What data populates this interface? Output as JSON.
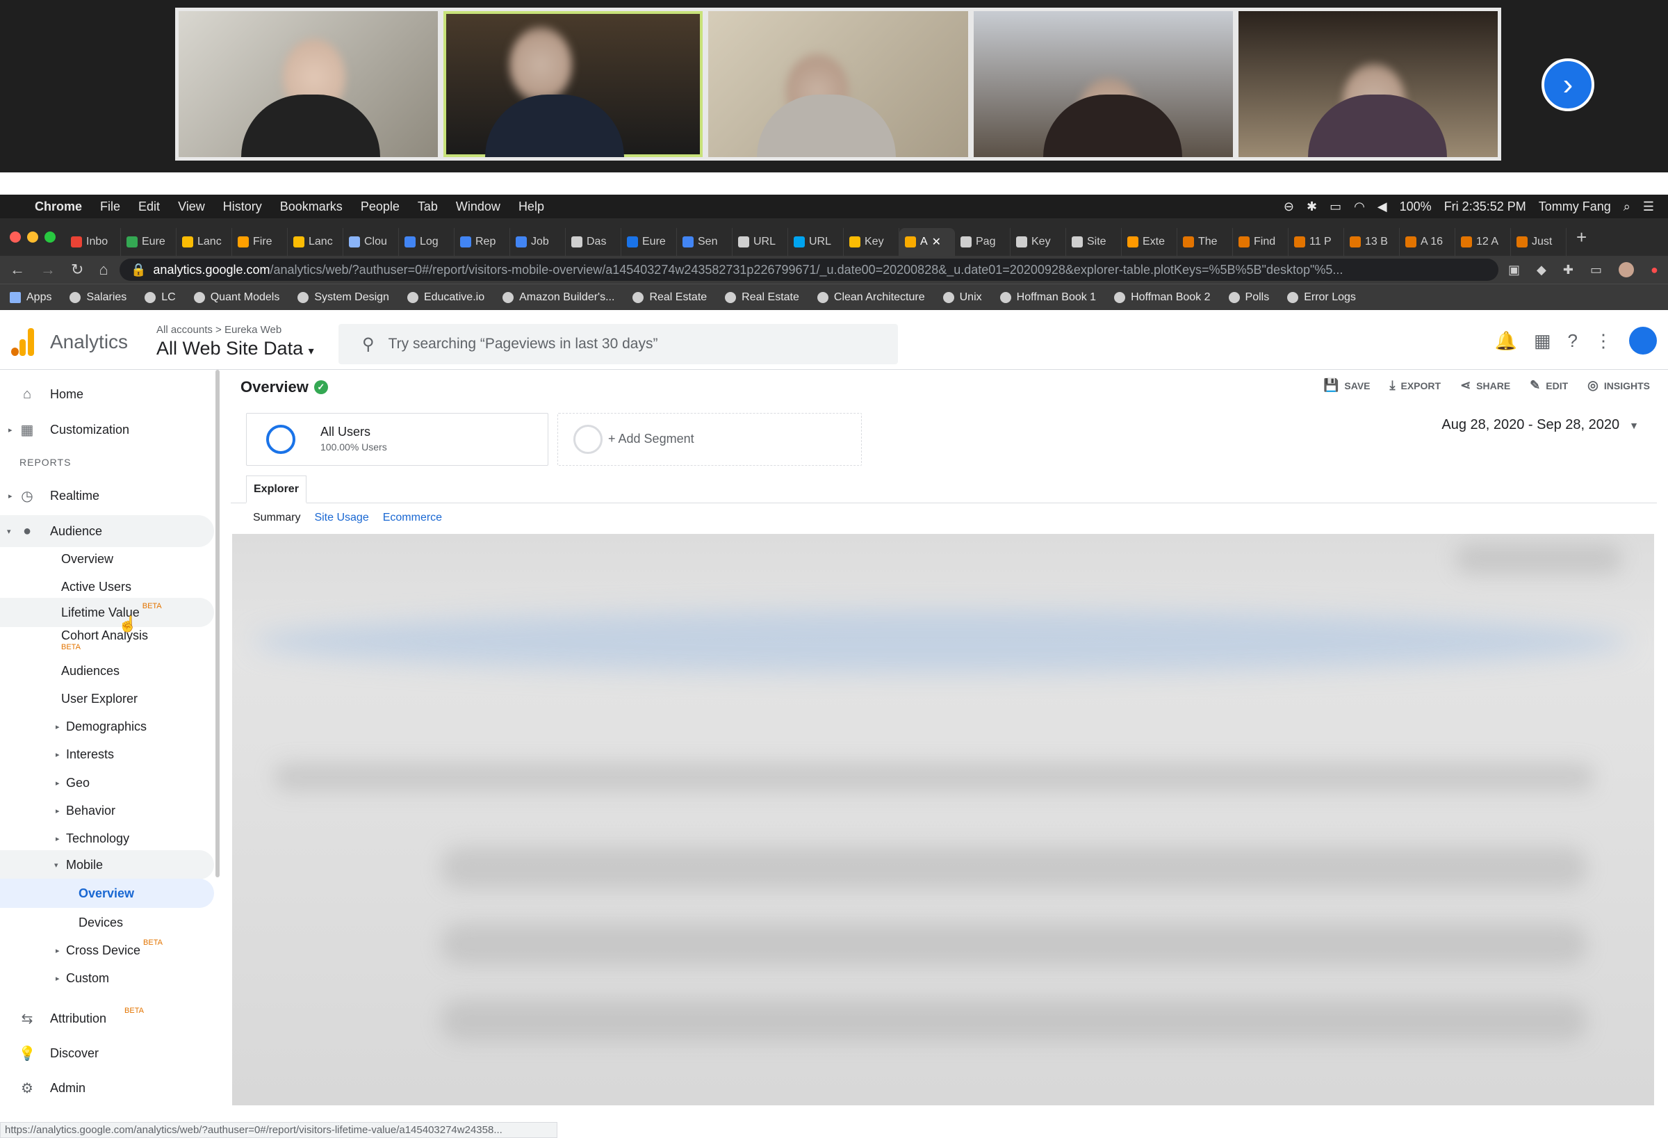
{
  "video_call": {
    "participants": [
      "participant-1",
      "participant-2",
      "participant-3",
      "participant-4",
      "participant-5"
    ],
    "next_label": "›"
  },
  "mac_menubar": {
    "items": [
      "Chrome",
      "File",
      "Edit",
      "View",
      "History",
      "Bookmarks",
      "People",
      "Tab",
      "Window",
      "Help"
    ],
    "battery": "100%",
    "clock": "Fri 2:35:52 PM",
    "user": "Tommy Fang"
  },
  "chrome_tabs": [
    {
      "label": "Inbo",
      "color": "#ea4335"
    },
    {
      "label": "Eure",
      "color": "#34a853"
    },
    {
      "label": "Lanc",
      "color": "#fbbc04"
    },
    {
      "label": "Fire",
      "color": "#ffa000"
    },
    {
      "label": "Lanc",
      "color": "#fbbc04"
    },
    {
      "label": "Clou",
      "color": "#8ab4f8"
    },
    {
      "label": "Log",
      "color": "#4285f4"
    },
    {
      "label": "Rep",
      "color": "#4285f4"
    },
    {
      "label": "Job",
      "color": "#4285f4"
    },
    {
      "label": "Das",
      "color": "#cfcfcf"
    },
    {
      "label": "Eure",
      "color": "#1a73e8"
    },
    {
      "label": "Sen",
      "color": "#4285f4"
    },
    {
      "label": "URL",
      "color": "#cfcfcf"
    },
    {
      "label": "URL",
      "color": "#00a4ef"
    },
    {
      "label": "Key",
      "color": "#fbbc04"
    },
    {
      "label": "A",
      "color": "#f9ab00",
      "active": true
    },
    {
      "label": "Pag",
      "color": "#cfcfcf"
    },
    {
      "label": "Key",
      "color": "#cfcfcf"
    },
    {
      "label": "Site",
      "color": "#cfcfcf"
    },
    {
      "label": "Exte",
      "color": "#ff9900"
    },
    {
      "label": "The",
      "color": "#e37400"
    },
    {
      "label": "Find",
      "color": "#e37400"
    },
    {
      "label": "11 P",
      "color": "#e37400"
    },
    {
      "label": "13 B",
      "color": "#e37400"
    },
    {
      "label": "A 16",
      "color": "#e37400"
    },
    {
      "label": "12 A",
      "color": "#e37400"
    },
    {
      "label": "Just",
      "color": "#e37400"
    }
  ],
  "address_bar": {
    "host": "analytics.google.com",
    "path": "/analytics/web/?authuser=0#/report/visitors-mobile-overview/a145403274w243582731p226799671/_u.date00=20200828&_u.date01=20200928&explorer-table.plotKeys=%5B%5B\"desktop\"%5..."
  },
  "bookmarks": [
    "Apps",
    "Salaries",
    "LC",
    "Quant Models",
    "System Design",
    "Educative.io",
    "Amazon Builder's...",
    "Real Estate",
    "Real Estate",
    "Clean Architecture",
    "Unix",
    "Hoffman Book 1",
    "Hoffman Book 2",
    "Polls",
    "Error Logs"
  ],
  "ga_header": {
    "product": "Analytics",
    "account_crumb": "All accounts > Eureka Web",
    "view": "All Web Site Data",
    "search_placeholder": "Try searching “Pageviews in last 30 days”"
  },
  "sidebar": {
    "home": "Home",
    "customization": "Customization",
    "reports_label": "REPORTS",
    "realtime": "Realtime",
    "audience": "Audience",
    "audience_items": [
      "Overview",
      "Active Users",
      "Lifetime Value",
      "Cohort Analysis",
      "Audiences",
      "User Explorer",
      "Demographics",
      "Interests",
      "Geo",
      "Behavior",
      "Technology",
      "Mobile"
    ],
    "mobile_items": [
      "Overview",
      "Devices"
    ],
    "cross_device": "Cross Device",
    "custom": "Custom",
    "attribution": "Attribution",
    "discover": "Discover",
    "admin": "Admin",
    "beta": "BETA"
  },
  "main": {
    "title": "Overview",
    "toolbar": {
      "save": "SAVE",
      "export": "EXPORT",
      "share": "SHARE",
      "edit": "EDIT",
      "insights": "INSIGHTS"
    },
    "segment": {
      "name": "All Users",
      "pct": "100.00% Users",
      "add": "+ Add Segment"
    },
    "date_range": "Aug 28, 2020 - Sep 28, 2020",
    "explorer_tab": "Explorer",
    "subtabs": [
      "Summary",
      "Site Usage",
      "Ecommerce"
    ]
  },
  "status_url": "https://analytics.google.com/analytics/web/?authuser=0#/report/visitors-lifetime-value/a145403274w24358..."
}
